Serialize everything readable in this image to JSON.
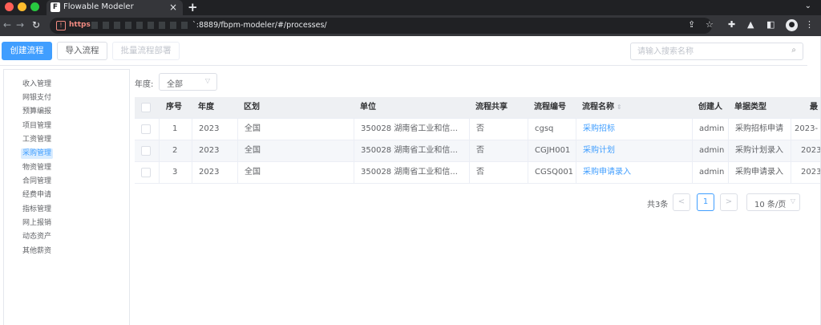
{
  "browser": {
    "tab_title": "Flowable Modeler",
    "tab_close": "×",
    "new_tab": "+",
    "tab_menu": "⌄",
    "url_scheme": "https",
    "url": "`:8889/fbpm-modeler/#/processes/",
    "traffic_colors": [
      "#ff5f57",
      "#febc2e",
      "#28c840"
    ]
  },
  "toolbar": {
    "create_label": "创建流程",
    "import_label": "导入流程",
    "batch_deploy_label": "批量流程部署"
  },
  "search": {
    "placeholder": "请输入搜索名称"
  },
  "sidebar": {
    "items": [
      {
        "label": "收入管理",
        "active": false
      },
      {
        "label": "网银支付",
        "active": false
      },
      {
        "label": "预算编报",
        "active": false
      },
      {
        "label": "项目管理",
        "active": false
      },
      {
        "label": "工资管理",
        "active": false
      },
      {
        "label": "采购管理",
        "active": true
      },
      {
        "label": "物资管理",
        "active": false
      },
      {
        "label": "合同管理",
        "active": false
      },
      {
        "label": "经费申请",
        "active": false
      },
      {
        "label": "指标管理",
        "active": false
      },
      {
        "label": "网上报销",
        "active": false
      },
      {
        "label": "动态资产",
        "active": false
      },
      {
        "label": "其他薪资",
        "active": false
      }
    ]
  },
  "filter": {
    "year_label": "年度:",
    "year_value": "全部"
  },
  "table": {
    "columns": [
      "序号",
      "年度",
      "区划",
      "单位",
      "流程共享",
      "流程编号",
      "流程名称",
      "创建人",
      "单据类型",
      "最"
    ],
    "rows": [
      [
        "1",
        "2023",
        "全国",
        "350028 湖南省工业和信...",
        "否",
        "cgsq",
        "采购招标",
        "admin",
        "采购招标申请",
        "2023-"
      ],
      [
        "2",
        "2023",
        "全国",
        "350028 湖南省工业和信...",
        "否",
        "CGJH001",
        "采购计划",
        "admin",
        "采购计划录入",
        "2023"
      ],
      [
        "3",
        "2023",
        "全国",
        "350028 湖南省工业和信...",
        "否",
        "CGSQ001",
        "采购申请录入",
        "admin",
        "采购申请录入",
        "2023"
      ]
    ]
  },
  "pagination": {
    "total": "共3条",
    "prev": "<",
    "current": "1",
    "next": ">",
    "page_size": "10 条/页"
  },
  "colors": {
    "primary": "#409eff",
    "active_bg": "#d9ecff"
  }
}
